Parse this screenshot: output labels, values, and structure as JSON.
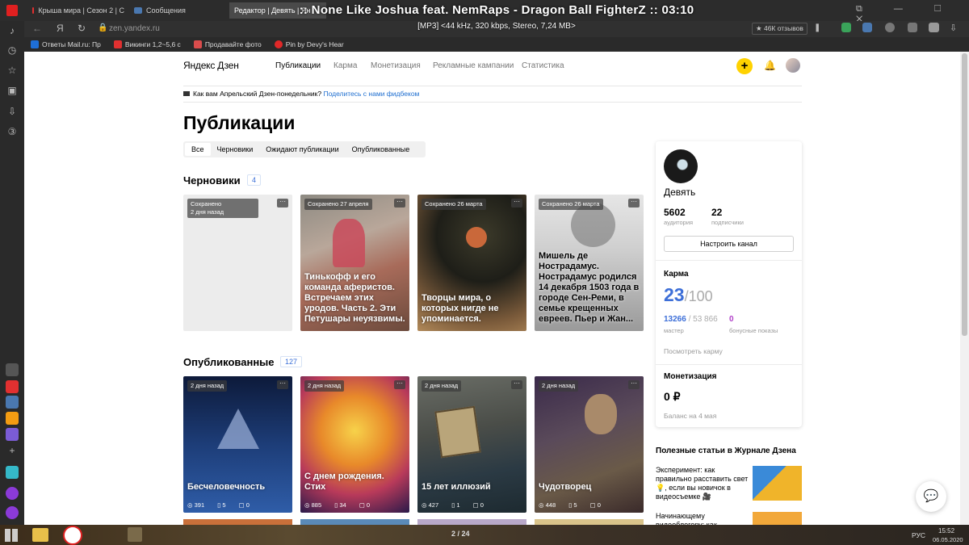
{
  "browser": {
    "tabs": [
      {
        "title": "Крыша мира | Сезон 2 | С",
        "color": "#e23030"
      },
      {
        "title": "Сообщения",
        "color": "#4a78b0"
      },
      {
        "title": "Редактор | Девять | Ян",
        "active": true
      }
    ],
    "address": "zen.yandex.ru",
    "reviews": "★ 46К отзывов",
    "bookmarks": [
      {
        "label": "Ответы Mail.ru: Пр",
        "color": "#1e6fd8"
      },
      {
        "label": "Викинги 1,2~5,6 с",
        "color": "#e03030"
      },
      {
        "label": "Продавайте фото",
        "color": "#d94c4c"
      },
      {
        "label": "Pin by Devy's Hear",
        "color": "#e02828"
      }
    ],
    "media_overlay": ":: None Like Joshua feat. NemRaps - Dragon Ball FighterZ :: 03:10",
    "media_info": "[MP3] <44 kHz, 320 kbps, Stereo, 7,24 MB>",
    "window_title": "Редактор | Девять | Яндекс.Дзен"
  },
  "header": {
    "logo": "Яндекс Дзен",
    "nav": [
      {
        "label": "Публикации",
        "active": true
      },
      {
        "label": "Карма"
      },
      {
        "label": "Монетизация"
      },
      {
        "label": "Рекламные кампании"
      },
      {
        "label": "Статистика"
      }
    ],
    "plus": "+"
  },
  "survey": {
    "text": "Как вам Апрельский Дзен-понедельник?",
    "link": "Поделитесь с нами фидбеком"
  },
  "page_title": "Публикации",
  "filters": [
    {
      "label": "Все",
      "active": true
    },
    {
      "label": "Черновики"
    },
    {
      "label": "Ожидают публикации"
    },
    {
      "label": "Опубликованные"
    }
  ],
  "drafts": {
    "title": "Черновики",
    "count": "4",
    "cards": [
      {
        "badge": "Сохранено\n2 дня назад",
        "title": ""
      },
      {
        "badge": "Сохранено 27 апреля",
        "title": "Тинькофф и его команда аферистов. Встречаем этих уродов. Часть 2. Эти Петушары неуязвимы."
      },
      {
        "badge": "Сохранено 26 марта",
        "title": "Творцы мира, о которых нигде не упоминается."
      },
      {
        "badge": "Сохранено 26 марта",
        "title": "Мишель де Нострадамус. Нострадамус родился 14 декабря 1503 года в городе Сен-Реми, в семье крещенных евреев. Пьер и Жан..."
      }
    ]
  },
  "published": {
    "title": "Опубликованные",
    "count": "127",
    "cards": [
      {
        "badge": "2 дня назад",
        "title": "Бесчеловечность",
        "views": "391",
        "reads": "5",
        "comments": "0"
      },
      {
        "badge": "2 дня назад",
        "title": "С днем рождения. Стих",
        "views": "885",
        "reads": "34",
        "comments": "0"
      },
      {
        "badge": "2 дня назад",
        "title": "15 лет иллюзий",
        "views": "427",
        "reads": "1",
        "comments": "0"
      },
      {
        "badge": "2 дня назад",
        "title": "Чудотворец",
        "views": "448",
        "reads": "5",
        "comments": "0"
      }
    ]
  },
  "channel": {
    "name": "Девять",
    "audience": "5602",
    "audience_label": "аудитория",
    "subscribers": "22",
    "subscribers_label": "подписчики",
    "setup_button": "Настроить канал",
    "karma_title": "Карма",
    "karma_value": "23",
    "karma_max": "/100",
    "master_value": "13266",
    "master_total": "/ 53 866",
    "master_label": "мастер",
    "bonus_value": "0",
    "bonus_label": "бонусные показы",
    "karma_link": "Посмотреть карму",
    "monetization_title": "Монетизация",
    "balance": "0 ₽",
    "balance_label": "Баланс на 4 мая"
  },
  "journal": {
    "title": "Полезные статьи в Журнале Дзена",
    "articles": [
      {
        "text": "Эксперимент: как правильно расставить свет 💡, если вы новичок в видеосъемке 🎥"
      },
      {
        "text": "Начинающему видеоблогеру: как"
      }
    ]
  },
  "taskbar": {
    "page_counter": "2 / 24",
    "lang": "РУС",
    "time": "15:52",
    "date": "06.05.2020"
  }
}
